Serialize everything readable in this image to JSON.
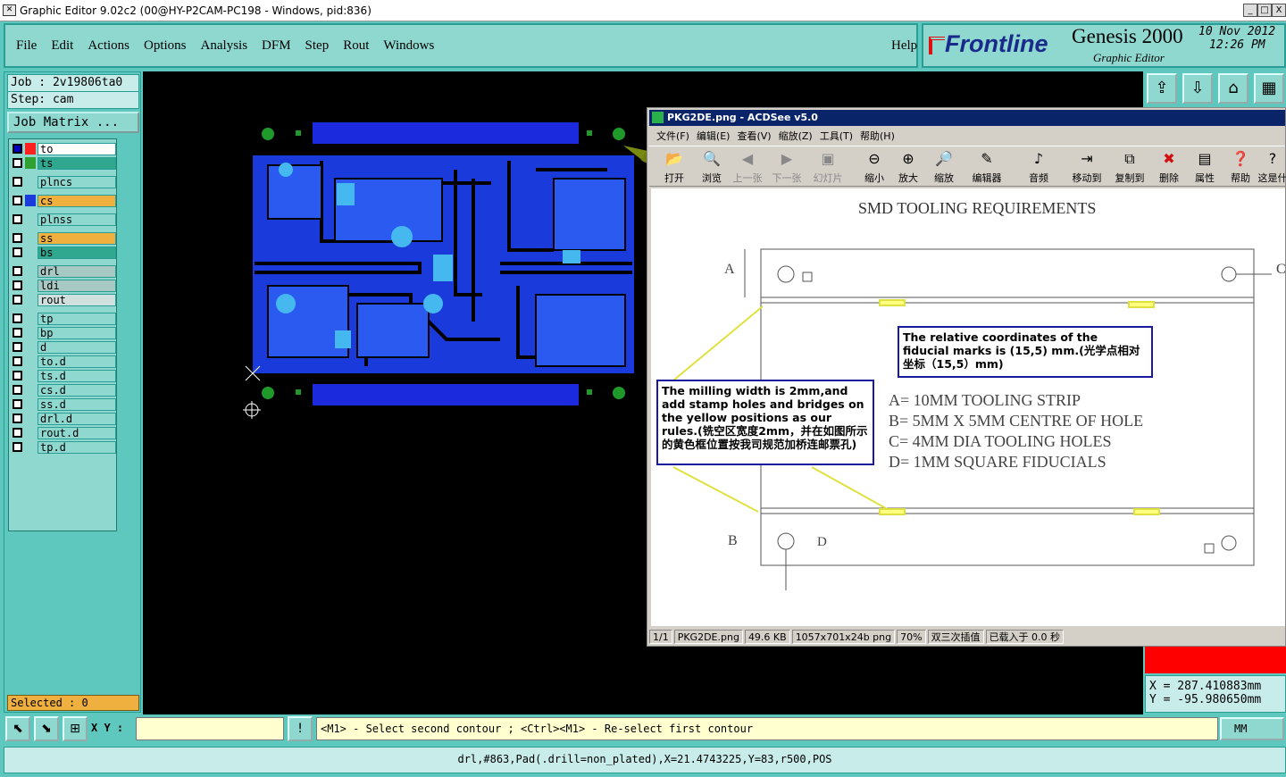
{
  "window": {
    "title": "Graphic Editor 9.02c2 (00@HY-P2CAM-PC198 - Windows, pid:836)",
    "min": "_",
    "max": "□",
    "close": "X"
  },
  "menu": [
    "File",
    "Edit",
    "Actions",
    "Options",
    "Analysis",
    "DFM",
    "Step",
    "Rout",
    "Windows"
  ],
  "help": "Help",
  "brand": {
    "logo": "Frontline",
    "product": "Genesis 2000",
    "subtitle": "Graphic Editor",
    "date": "10 Nov 2012",
    "time": "12:26 PM"
  },
  "job": "Job : 2v19806ta0",
  "step": "Step: cam",
  "job_matrix": "Job Matrix ...",
  "layers": [
    {
      "name": "to",
      "color": "#ff2020",
      "bg": "#ffffff"
    },
    {
      "name": "ts",
      "color": "#30a030",
      "bg": "#30a890"
    },
    {
      "name": "plncs",
      "color": "",
      "bg": "#8fd8d0"
    },
    {
      "name": "cs",
      "color": "#1a3adc",
      "bg": "#f0b040"
    },
    {
      "name": "plnss",
      "color": "",
      "bg": "#8fd8d0"
    },
    {
      "name": "ss",
      "color": "",
      "bg": "#f0b040"
    },
    {
      "name": "bs",
      "color": "",
      "bg": "#30a890"
    },
    {
      "name": "drl",
      "color": "",
      "bg": "#a8c8c4"
    },
    {
      "name": "ldi",
      "color": "",
      "bg": "#a8c8c4"
    },
    {
      "name": "rout",
      "color": "",
      "bg": "#d0e0de"
    },
    {
      "name": "tp",
      "color": "",
      "bg": "#8fd8d0"
    },
    {
      "name": "bp",
      "color": "",
      "bg": "#8fd8d0"
    },
    {
      "name": "d",
      "color": "",
      "bg": "#8fd8d0"
    },
    {
      "name": "to.d",
      "color": "",
      "bg": "#8fd8d0"
    },
    {
      "name": "ts.d",
      "color": "",
      "bg": "#8fd8d0"
    },
    {
      "name": "cs.d",
      "color": "",
      "bg": "#8fd8d0"
    },
    {
      "name": "ss.d",
      "color": "",
      "bg": "#8fd8d0"
    },
    {
      "name": "drl.d",
      "color": "",
      "bg": "#8fd8d0"
    },
    {
      "name": "rout.d",
      "color": "",
      "bg": "#8fd8d0"
    },
    {
      "name": "tp.d",
      "color": "",
      "bg": "#8fd8d0"
    }
  ],
  "selected": "Selected : 0",
  "coords": {
    "x": "X = 287.410883mm",
    "y": "Y = -95.980650mm"
  },
  "bottom": {
    "xy_label": "X Y :",
    "xy_value": "",
    "prompt": "<M1> - Select second contour ; <Ctrl><M1> - Re-select first contour",
    "units": "MM"
  },
  "status": "drl,#863,Pad(.drill=non_plated),X=21.4743225,Y=83,r500,POS",
  "acdsee": {
    "title": "PKG2DE.png - ACDSee v5.0",
    "menu": [
      "文件(F)",
      "编辑(E)",
      "查看(V)",
      "缩放(Z)",
      "工具(T)",
      "帮助(H)"
    ],
    "toolbar": [
      {
        "label": "打开",
        "icon": "folder-icon",
        "enabled": true
      },
      {
        "label": "浏览",
        "icon": "browse-icon",
        "enabled": true
      },
      {
        "label": "上一张",
        "icon": "prev-icon",
        "enabled": false
      },
      {
        "label": "下一张",
        "icon": "next-icon",
        "enabled": false
      },
      {
        "label": "幻灯片",
        "icon": "slideshow-icon",
        "enabled": false
      },
      {
        "label": "缩小",
        "icon": "zoom-out-icon",
        "enabled": true
      },
      {
        "label": "放大",
        "icon": "zoom-in-icon",
        "enabled": true
      },
      {
        "label": "缩放",
        "icon": "zoom-icon",
        "enabled": true
      },
      {
        "label": "编辑器",
        "icon": "editor-icon",
        "enabled": true
      },
      {
        "label": "音频",
        "icon": "audio-icon",
        "enabled": true
      },
      {
        "label": "移动到",
        "icon": "move-icon",
        "enabled": true
      },
      {
        "label": "复制到",
        "icon": "copy-icon",
        "enabled": true
      },
      {
        "label": "删除",
        "icon": "delete-icon",
        "enabled": true
      },
      {
        "label": "属性",
        "icon": "properties-icon",
        "enabled": true
      },
      {
        "label": "帮助",
        "icon": "help-icon",
        "enabled": true
      },
      {
        "label": "这是什",
        "icon": "whatsthis-icon",
        "enabled": true
      }
    ],
    "status": [
      "1/1",
      "PKG2DE.png",
      "49.6 KB",
      "1057x701x24b png",
      "70%",
      "双三次插值",
      "已载入于 0.0 秒"
    ],
    "doc": {
      "heading": "SMD TOOLING REQUIREMENTS",
      "label_a": "A",
      "label_b": "B",
      "label_c": "C",
      "label_d": "D",
      "note_fiducial": "The relative coordinates of the fiducial marks is (15,5) mm.(光学点相对坐标（15,5）mm)",
      "note_milling": "The milling width is 2mm,and add stamp holes and bridges on the yellow positions as our rules.(铣空区宽度2mm，并在如图所示的黄色框位置按我司规范加桥连邮票孔)",
      "spec": [
        "A= 10MM TOOLING STRIP",
        "B= 5MM X 5MM CENTRE OF HOLE",
        "C= 4MM DIA TOOLING HOLES",
        "D= 1MM SQUARE FIDUCIALS"
      ]
    }
  }
}
